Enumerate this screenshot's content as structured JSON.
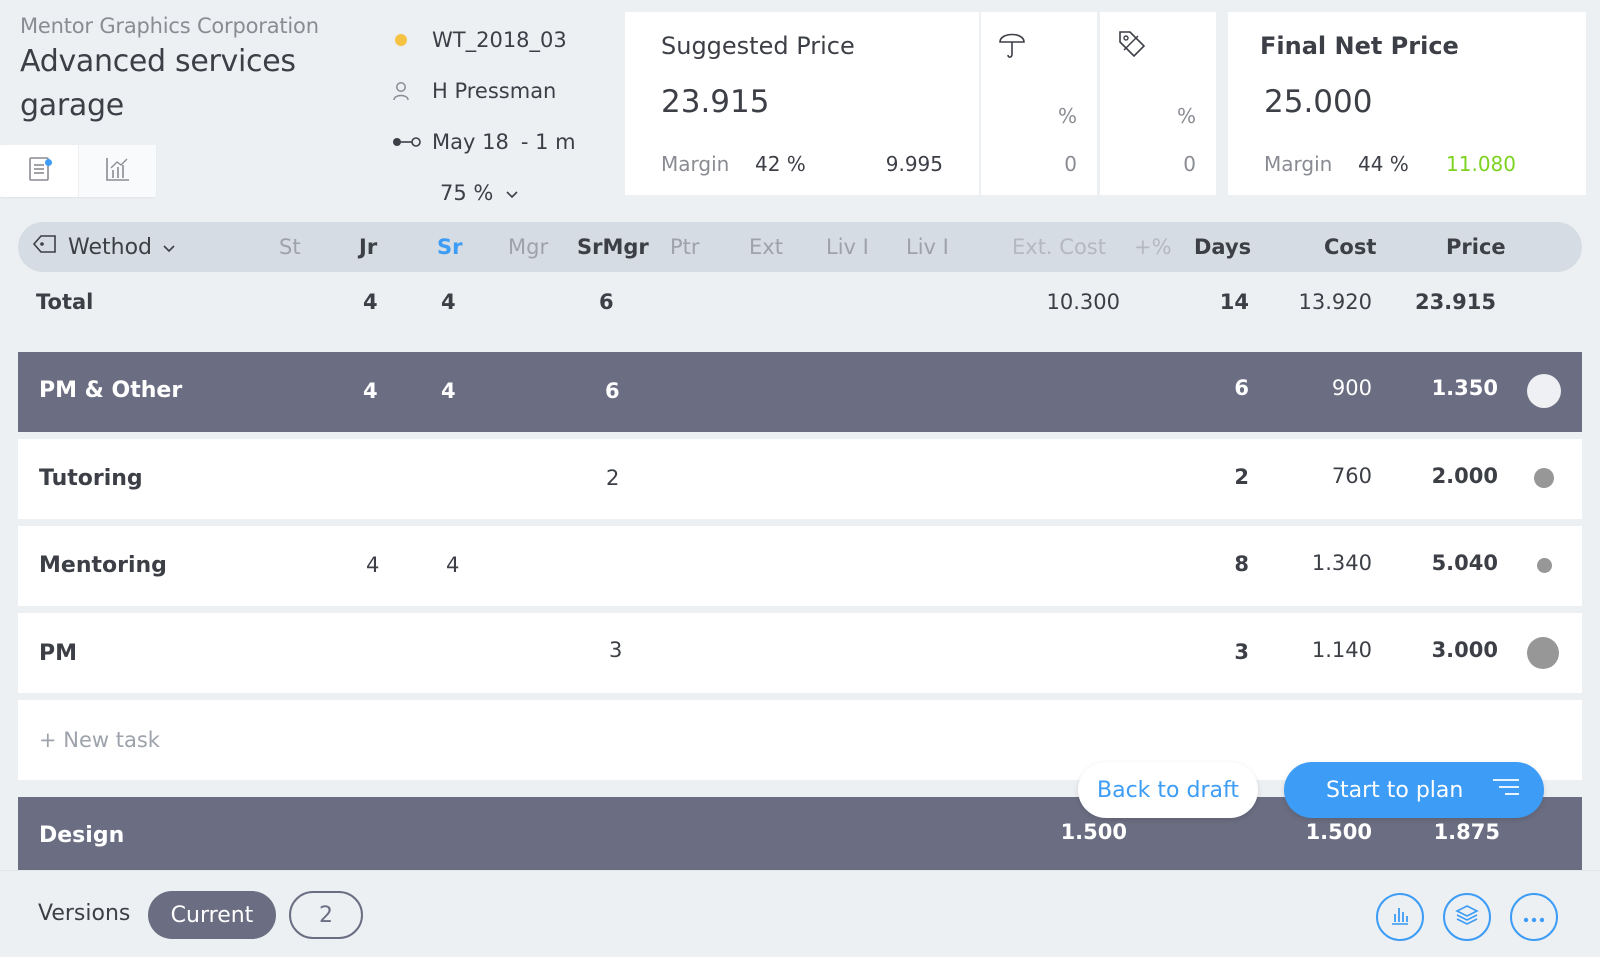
{
  "header": {
    "company": "Mentor Graphics Corporation",
    "project": "Advanced services garage",
    "view_icons": [
      "document-icon",
      "chart-icon"
    ]
  },
  "meta": {
    "code": "WT_2018_03",
    "owner": "H Pressman",
    "date": "May 18",
    "duration": "- 1 m",
    "probability": "75 %"
  },
  "cards": {
    "suggested": {
      "title": "Suggested Price",
      "price": "23.915",
      "margin_label": "Margin",
      "margin_pct": "42 %",
      "margin_value": "9.995"
    },
    "adjust_a": {
      "icon": "umbrella-icon",
      "pct": "%",
      "value": "0"
    },
    "adjust_b": {
      "icon": "price-tag-icon",
      "pct": "%",
      "value": "0"
    },
    "final": {
      "title": "Final Net Price",
      "price": "25.000",
      "margin_label": "Margin",
      "margin_pct": "44 %",
      "margin_value": "11.080"
    }
  },
  "columns": {
    "method": "Wethod",
    "roles": [
      "St",
      "Jr",
      "Sr",
      "Mgr",
      "SrMgr",
      "Ptr",
      "Ext",
      "Liv I",
      "Liv I"
    ],
    "ext_cost": "Ext. Cost",
    "markup": "+%",
    "days": "Days",
    "cost": "Cost",
    "price": "Price"
  },
  "total": {
    "label": "Total",
    "jr": "4",
    "sr": "4",
    "srmgr": "6",
    "ext_cost": "10.300",
    "days": "14",
    "cost": "13.920",
    "price": "23.915"
  },
  "groups": [
    {
      "name": "PM & Other",
      "jr": "4",
      "sr": "4",
      "srmgr": "6",
      "days": "6",
      "cost": "900",
      "price": "1.350",
      "tasks": [
        {
          "name": "Tutoring",
          "jr": "",
          "sr": "",
          "srmgr": "2",
          "days": "2",
          "cost": "760",
          "price": "2.000"
        },
        {
          "name": "Mentoring",
          "jr": "4",
          "sr": "4",
          "srmgr": "",
          "days": "8",
          "cost": "1.340",
          "price": "5.040"
        },
        {
          "name": "PM",
          "jr": "",
          "sr": "",
          "srmgr": "3",
          "days": "3",
          "cost": "1.140",
          "price": "3.000"
        }
      ],
      "new_task": "+ New task"
    },
    {
      "name": "Design",
      "ext_cost": "1.500",
      "cost": "1.500",
      "price": "1.875"
    }
  ],
  "actions": {
    "back_to_draft": "Back to draft",
    "start_to_plan": "Start to plan"
  },
  "footer": {
    "versions_label": "Versions",
    "current": "Current",
    "version_2": "2",
    "buttons": [
      "bar-chart-icon",
      "layers-icon",
      "more-icon"
    ]
  },
  "colors": {
    "accent": "#3d9cf5",
    "group_bg": "#6b6e82",
    "positive": "#7ed321",
    "pending": "#f5c244"
  }
}
